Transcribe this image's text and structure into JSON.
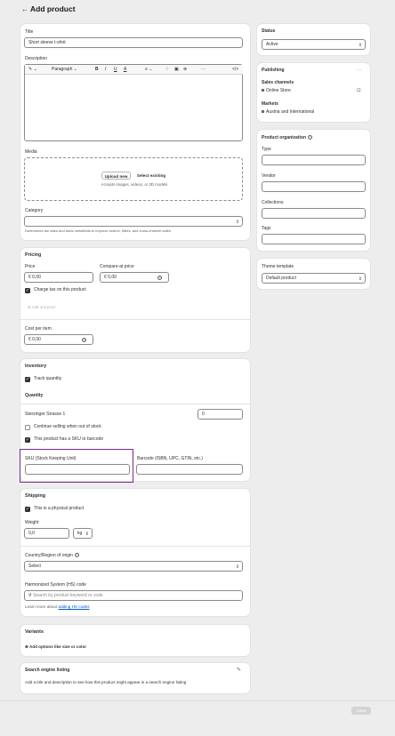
{
  "header": {
    "back_icon": "arrow-left-icon",
    "title": "Add product"
  },
  "main": {
    "title_label": "Title",
    "title_value": "Short sleeve t-shirt",
    "description_label": "Description",
    "toolbar": {
      "paragraph": "Paragraph",
      "more": "···",
      "code": "</>"
    },
    "media_label": "Media",
    "upload_button": "Upload new",
    "select_existing": "Select existing",
    "media_hint": "Accepts images, videos, or 3D models",
    "category_label": "Category",
    "category_help": "Determines tax rates and adds metafields to improve search, filters, and cross-channel sales"
  },
  "pricing": {
    "title": "Pricing",
    "price_label": "Price",
    "price_value": "€ 0,00",
    "compare_label": "Compare-at price",
    "compare_value": "€ 0,00",
    "charge_tax": "Charge tax on this product",
    "add_unit_price": "Add unit price",
    "cost_label": "Cost per item",
    "cost_value": "€ 0,00"
  },
  "inventory": {
    "title": "Inventory",
    "track": "Track quantity",
    "quantity_title": "Quantity",
    "location": "Sterzinger Strasse 1",
    "quantity_value": "0",
    "continue_selling": "Continue selling when out of stock",
    "has_sku": "This product has a SKU or barcode",
    "sku_label": "SKU (Stock Keeping Unit)",
    "barcode_label": "Barcode (ISBN, UPC, GTIN, etc.)"
  },
  "shipping": {
    "title": "Shipping",
    "physical": "This is a physical product",
    "weight_label": "Weight",
    "weight_value": "0,0",
    "weight_unit": "kg",
    "country_label": "Country/Region of origin",
    "country_value": "Select",
    "hs_label": "Harmonized System (HS) code",
    "hs_placeholder": "Search by product keyword or code",
    "learn_more": "Learn more about ",
    "learn_link": "adding HS codes"
  },
  "variants": {
    "title": "Variants",
    "add_options": "Add options like size or color"
  },
  "seo": {
    "title": "Search engine listing",
    "desc": "Add a title and description to see how this product might appear in a search engine listing"
  },
  "sidebar": {
    "status_title": "Status",
    "status_value": "Active",
    "publishing_title": "Publishing",
    "publishing_more": "···",
    "sales_channels": "Sales channels",
    "online_store": "Online Store",
    "markets": "Markets",
    "markets_value": "Austria and International",
    "org_title": "Product organization",
    "type_label": "Type",
    "vendor_label": "Vendor",
    "collections_label": "Collections",
    "tags_label": "Tags",
    "theme_title": "Theme template",
    "theme_value": "Default product"
  },
  "footer": {
    "save": "Save"
  },
  "colors": {
    "highlight": "#7b2c8f",
    "accent_link": "#005bd3",
    "background": "#ededed"
  }
}
